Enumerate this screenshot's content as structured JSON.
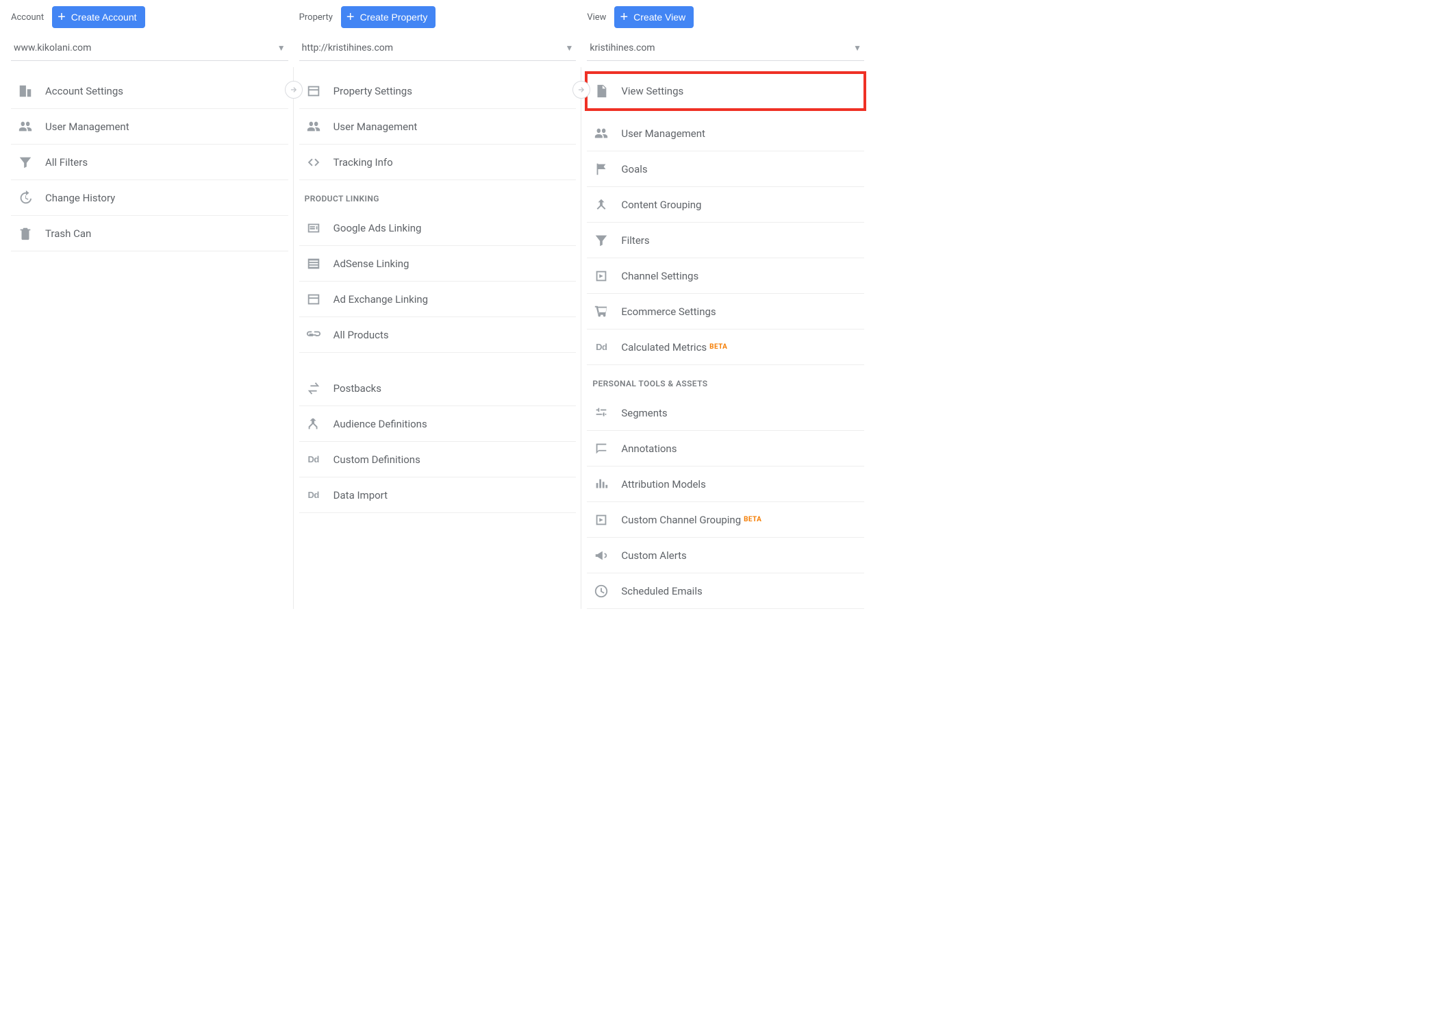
{
  "account": {
    "title": "Account",
    "create_label": "Create Account",
    "selected": "www.kikolani.com",
    "items": [
      {
        "label": "Account Settings",
        "icon": "building"
      },
      {
        "label": "User Management",
        "icon": "users"
      },
      {
        "label": "All Filters",
        "icon": "funnel"
      },
      {
        "label": "Change History",
        "icon": "history"
      },
      {
        "label": "Trash Can",
        "icon": "trash"
      }
    ]
  },
  "property": {
    "title": "Property",
    "create_label": "Create Property",
    "selected": "http://kristihines.com",
    "items": [
      {
        "label": "Property Settings",
        "icon": "layout"
      },
      {
        "label": "User Management",
        "icon": "users"
      },
      {
        "label": "Tracking Info",
        "icon": "code"
      }
    ],
    "section1_title": "PRODUCT LINKING",
    "section1_items": [
      {
        "label": "Google Ads Linking",
        "icon": "news"
      },
      {
        "label": "AdSense Linking",
        "icon": "listbox"
      },
      {
        "label": "Ad Exchange Linking",
        "icon": "layout"
      },
      {
        "label": "All Products",
        "icon": "link"
      }
    ],
    "section2_items": [
      {
        "label": "Postbacks",
        "icon": "swap"
      },
      {
        "label": "Audience Definitions",
        "icon": "split"
      },
      {
        "label": "Custom Definitions",
        "icon": "dd"
      },
      {
        "label": "Data Import",
        "icon": "dd"
      }
    ]
  },
  "view": {
    "title": "View",
    "create_label": "Create View",
    "selected": "kristihines.com",
    "items": [
      {
        "label": "View Settings",
        "icon": "page",
        "highlighted": true
      },
      {
        "label": "User Management",
        "icon": "users"
      },
      {
        "label": "Goals",
        "icon": "flag"
      },
      {
        "label": "Content Grouping",
        "icon": "merge"
      },
      {
        "label": "Filters",
        "icon": "funnel"
      },
      {
        "label": "Channel Settings",
        "icon": "channel"
      },
      {
        "label": "Ecommerce Settings",
        "icon": "cart"
      },
      {
        "label": "Calculated Metrics",
        "icon": "dd",
        "beta": "BETA"
      }
    ],
    "section_title": "PERSONAL TOOLS & ASSETS",
    "section_items": [
      {
        "label": "Segments",
        "icon": "sliders"
      },
      {
        "label": "Annotations",
        "icon": "comment"
      },
      {
        "label": "Attribution Models",
        "icon": "bars"
      },
      {
        "label": "Custom Channel Grouping",
        "icon": "channel",
        "beta": "BETA"
      },
      {
        "label": "Custom Alerts",
        "icon": "megaphone"
      },
      {
        "label": "Scheduled Emails",
        "icon": "clock"
      }
    ]
  }
}
